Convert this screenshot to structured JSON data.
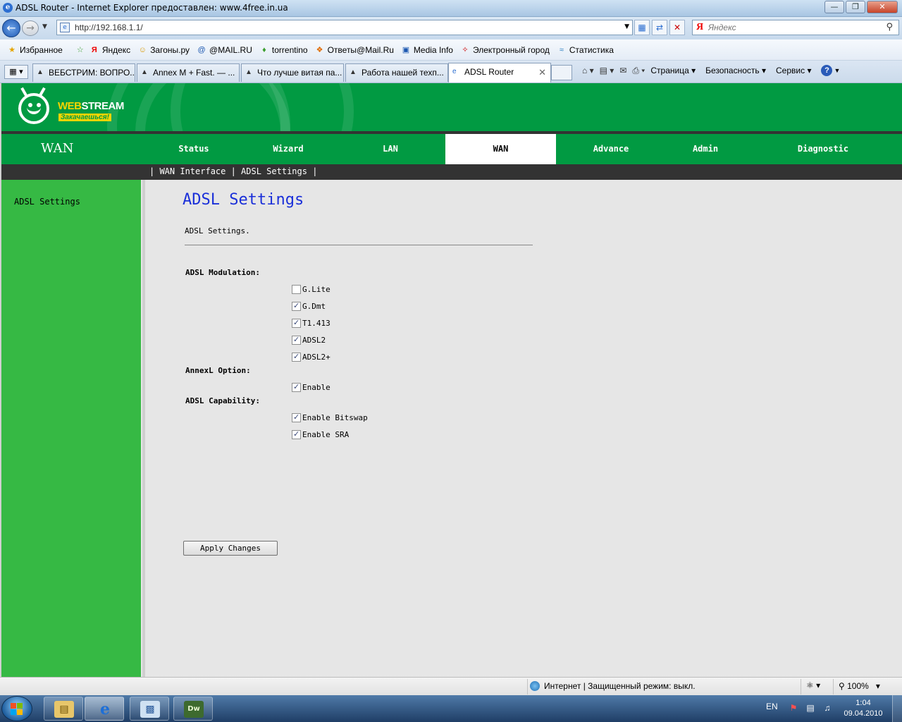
{
  "window": {
    "title": "ADSL Router - Internet Explorer предоставлен: www.4free.in.ua",
    "url": "http://192.168.1.1/",
    "search_placeholder": "Яндекс"
  },
  "favorites": {
    "label": "Избранное",
    "items": [
      "Яндекс",
      "Загоны.ру",
      "@MAIL.RU",
      "torrentino",
      "Ответы@Mail.Ru",
      "Media Info",
      "Электронный город",
      "Статистика"
    ]
  },
  "tabs": [
    {
      "label": "ВЕБСТРИМ: ВОПРО...",
      "active": false
    },
    {
      "label": "Annex M + Fast. — ...",
      "active": false
    },
    {
      "label": "Что лучше витая па...",
      "active": false
    },
    {
      "label": "Работа нашей техп...",
      "active": false
    },
    {
      "label": "ADSL Router",
      "active": true
    }
  ],
  "commandbar": {
    "page": "Страница",
    "safety": "Безопасность",
    "tools": "Сервис"
  },
  "router": {
    "logo": {
      "web": "WEB",
      "stream": "STREAM",
      "tagline": "Закачаешься!"
    },
    "section": "WAN",
    "nav": [
      "Status",
      "Wizard",
      "LAN",
      "WAN",
      "Advance",
      "Admin",
      "Diagnostic"
    ],
    "nav_active": "WAN",
    "subnav": "| WAN Interface | ADSL Settings |",
    "sidebar_item": "ADSL Settings",
    "heading": "ADSL Settings",
    "description": "ADSL Settings.",
    "modulation_label": "ADSL Modulation:",
    "modulation": [
      {
        "label": "G.Lite",
        "checked": false
      },
      {
        "label": "G.Dmt",
        "checked": true
      },
      {
        "label": "T1.413",
        "checked": true
      },
      {
        "label": "ADSL2",
        "checked": true
      },
      {
        "label": "ADSL2+",
        "checked": true
      }
    ],
    "annexl_label": "AnnexL Option:",
    "annexl": [
      {
        "label": "Enable",
        "checked": true
      }
    ],
    "capability_label": "ADSL Capability:",
    "capability": [
      {
        "label": "Enable Bitswap",
        "checked": true
      },
      {
        "label": "Enable SRA",
        "checked": true
      }
    ],
    "apply_label": "Apply Changes"
  },
  "statusbar": {
    "zone": "Интернет | Защищенный режим: выкл.",
    "zoom": "100%"
  },
  "taskbar": {
    "lang": "EN",
    "time": "1:04",
    "date": "09.04.2010"
  },
  "colors": {
    "brand_green": "#019a42",
    "sidebar_green": "#36b944",
    "heading_blue": "#1a2fd9",
    "logo_yellow": "#f5d400"
  }
}
